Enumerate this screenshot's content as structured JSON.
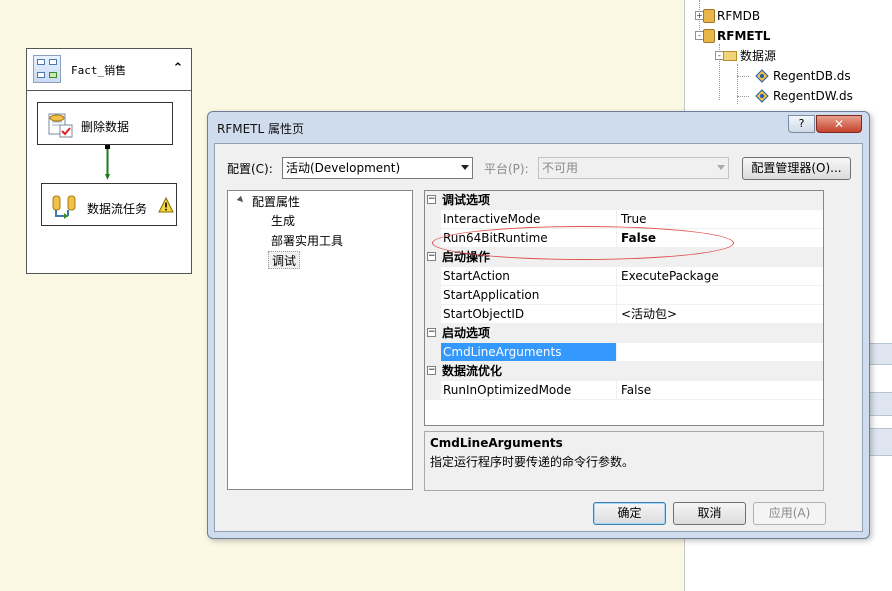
{
  "canvas": {
    "container_title": "Fact_销售",
    "collapse_glyph": "⌃",
    "tasks": [
      {
        "label": "删除数据",
        "icon": "sql-task-icon"
      },
      {
        "label": "数据流任务",
        "icon": "data-flow-icon",
        "warning": true
      }
    ]
  },
  "solution_explorer": {
    "items": [
      {
        "label": "RFMDB",
        "type": "project",
        "expander": "+"
      },
      {
        "label": "RFMETL",
        "type": "project",
        "expander": "-",
        "bold": true
      },
      {
        "label": "数据源",
        "type": "folder",
        "expander": "-"
      },
      {
        "label": "RegentDB.ds",
        "type": "datasource"
      },
      {
        "label": "RegentDW.ds",
        "type": "datasource"
      }
    ]
  },
  "dialog": {
    "title": "RFMETL 属性页",
    "help_glyph": "?",
    "close_glyph": "✕",
    "config_label": "配置(C):",
    "config_value": "活动(Development)",
    "platform_label": "平台(P):",
    "platform_value": "不可用",
    "config_manager_label": "配置管理器(O)...",
    "tree": {
      "root": "配置属性",
      "children": [
        "生成",
        "部署实用工具",
        "调试"
      ],
      "selected": "调试"
    },
    "grid": [
      {
        "kind": "category",
        "label": "调试选项"
      },
      {
        "kind": "prop",
        "name": "InteractiveMode",
        "value": "True"
      },
      {
        "kind": "prop",
        "name": "Run64BitRuntime",
        "value": "False",
        "bold": true
      },
      {
        "kind": "category",
        "label": "启动操作"
      },
      {
        "kind": "prop",
        "name": "StartAction",
        "value": "ExecutePackage"
      },
      {
        "kind": "prop",
        "name": "StartApplication",
        "value": ""
      },
      {
        "kind": "prop",
        "name": "StartObjectID",
        "value": "<活动包>"
      },
      {
        "kind": "category",
        "label": "启动选项"
      },
      {
        "kind": "prop",
        "name": "CmdLineArguments",
        "value": "",
        "selected": true
      },
      {
        "kind": "category",
        "label": "数据流优化"
      },
      {
        "kind": "prop",
        "name": "RunInOptimizedMode",
        "value": "False"
      }
    ],
    "description": {
      "title": "CmdLineArguments",
      "text": "指定运行程序时要传递的命令行参数。"
    },
    "buttons": {
      "ok": "确定",
      "cancel": "取消",
      "apply": "应用(A)"
    }
  },
  "colors": {
    "canvas_bg": "#fbf8e4",
    "dialog_frame": "#cfdcee",
    "selection": "#3399ff",
    "annotation_ellipse": "#e05050",
    "connector_green": "#1e7a1e"
  }
}
